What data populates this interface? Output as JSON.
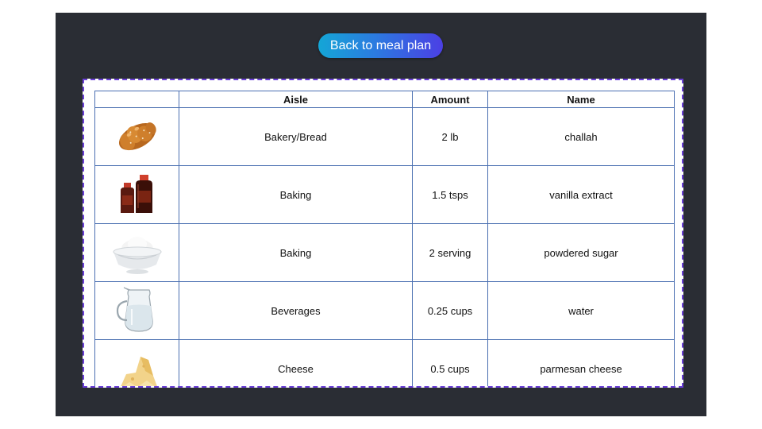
{
  "back_button": {
    "label": "Back to meal plan"
  },
  "table": {
    "headers": {
      "image": "",
      "aisle": "Aisle",
      "amount": "Amount",
      "name": "Name"
    },
    "rows": [
      {
        "icon": "challah-bread-image",
        "aisle": "Bakery/Bread",
        "amount": "2 lb",
        "name": "challah"
      },
      {
        "icon": "vanilla-extract-bottles-image",
        "aisle": "Baking",
        "amount": "1.5 tsps",
        "name": "vanilla extract"
      },
      {
        "icon": "powdered-sugar-bowl-image",
        "aisle": "Baking",
        "amount": "2 serving",
        "name": "powdered sugar"
      },
      {
        "icon": "water-pitcher-image",
        "aisle": "Beverages",
        "amount": "0.25 cups",
        "name": "water"
      },
      {
        "icon": "parmesan-cheese-image",
        "aisle": "Cheese",
        "amount": "0.5 cups",
        "name": "parmesan cheese"
      }
    ]
  }
}
